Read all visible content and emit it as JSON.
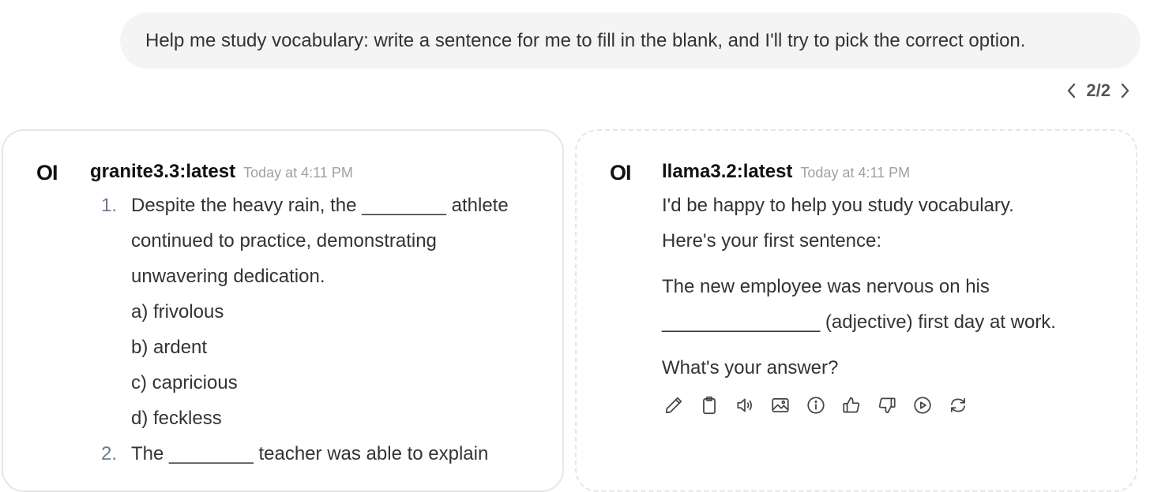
{
  "user_message": {
    "text": "Help me study vocabulary: write a sentence for me to fill in the blank, and I'll try to pick the correct option."
  },
  "pager": {
    "label": "2/2"
  },
  "left_response": {
    "avatar": "OI",
    "model": "granite3.3:latest",
    "time": "Today at 4:11 PM",
    "items": [
      {
        "num": "1.",
        "lines": [
          "Despite the heavy rain, the ________ athlete",
          "continued to practice, demonstrating",
          "unwavering dedication."
        ],
        "options": [
          "a) frivolous",
          "b) ardent",
          "c) capricious",
          "d) feckless"
        ]
      },
      {
        "num": "2.",
        "lines": [
          "The ________ teacher was able to explain"
        ]
      }
    ]
  },
  "right_response": {
    "avatar": "OI",
    "model": "llama3.2:latest",
    "time": "Today at 4:11 PM",
    "para1_line1": "I'd be happy to help you study vocabulary.",
    "para1_line2": "Here's your first sentence:",
    "para2_line1": "The new employee was nervous on his",
    "para2_line2": "_______________ (adjective) first day at work.",
    "para3": "What's your answer?",
    "actions": [
      "edit-icon",
      "copy-icon",
      "read-aloud-icon",
      "image-icon",
      "info-icon",
      "thumbs-up-icon",
      "thumbs-down-icon",
      "continue-icon",
      "regenerate-icon"
    ]
  }
}
